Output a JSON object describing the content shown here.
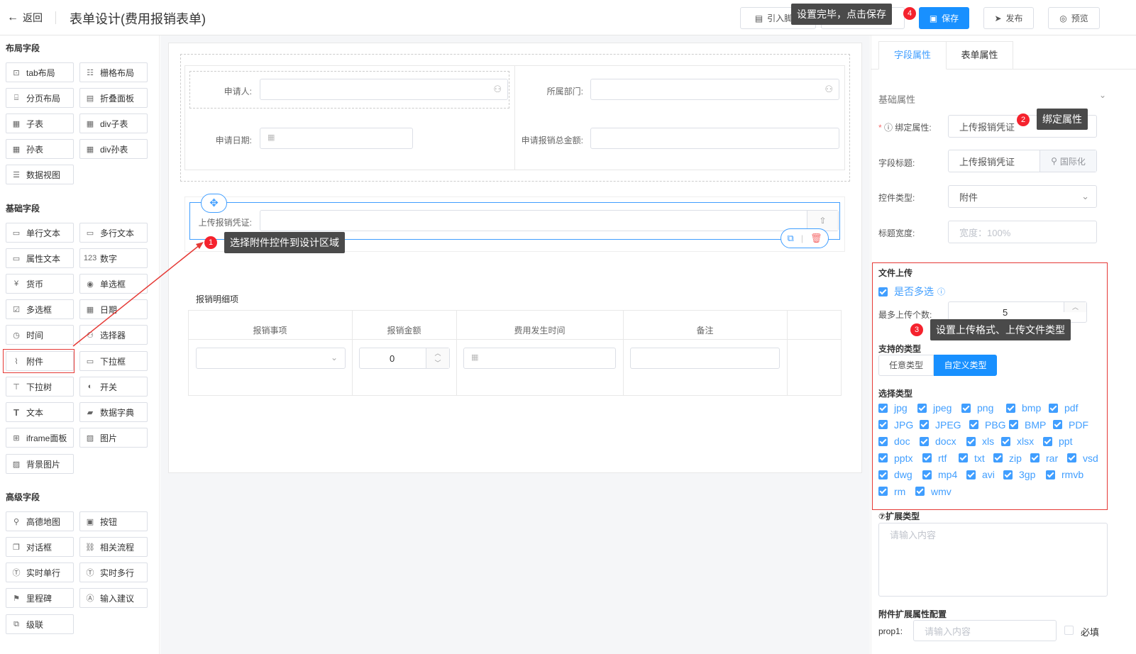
{
  "header": {
    "back_label": "返回",
    "title": "表单设计(费用报销表单)",
    "import_script": "引入脚本",
    "hidden_btn": "",
    "save": "保存",
    "publish": "发布",
    "preview": "预览"
  },
  "callouts": {
    "c1": "选择附件控件到设计区域",
    "c2": "绑定属性",
    "c3": "设置上传格式、上传文件类型",
    "c4": "设置完毕，点击保存",
    "n1": "1",
    "n2": "2",
    "n3": "3",
    "n4": "4"
  },
  "left": {
    "layout_title": "布局字段",
    "layout": [
      "tab布局",
      "栅格布局",
      "分页布局",
      "折叠面板",
      "子表",
      "div子表",
      "孙表",
      "div孙表",
      "数据视图"
    ],
    "basic_title": "基础字段",
    "basic": [
      "单行文本",
      "多行文本",
      "属性文本",
      "数字",
      "货币",
      "单选框",
      "多选框",
      "日期",
      "时间",
      "选择器",
      "附件",
      "下拉框",
      "下拉树",
      "开关",
      "文本",
      "数据字典",
      "iframe面板",
      "图片",
      "背景图片"
    ],
    "advanced_title": "高级字段",
    "advanced": [
      "高德地图",
      "按钮",
      "对话框",
      "相关流程",
      "实时单行",
      "实时多行",
      "里程碑",
      "输入建议",
      "级联"
    ]
  },
  "canvas": {
    "applicant": "申请人:",
    "department": "所属部门:",
    "apply_date": "申请日期:",
    "total_amount": "申请报销总金额:",
    "upload_label": "上传报销凭证:",
    "detail_title": "报销明细项",
    "columns": [
      "报销事项",
      "报销金额",
      "费用发生时间",
      "备注"
    ],
    "amount_value": "0"
  },
  "right": {
    "tab_field": "字段属性",
    "tab_form": "表单属性",
    "basic_props": "基础属性",
    "bind_label": "绑定属性:",
    "bind_value": "上传报销凭证",
    "title_label": "字段标题:",
    "title_value": "上传报销凭证",
    "i18n": "国际化",
    "type_label": "控件类型:",
    "type_value": "附件",
    "width_label": "标题宽度:",
    "width_placeholder": "宽度：100%",
    "upload_title": "文件上传",
    "multi_label": "是否多选",
    "max_label": "最多上传个数:",
    "max_value": "5",
    "support_title": "支持的类型",
    "any_type": "任意类型",
    "custom_type": "自定义类型",
    "select_title": "选择类型",
    "types": [
      [
        "jpg",
        "jpeg",
        "png",
        "bmp",
        "pdf"
      ],
      [
        "JPG",
        "JPEG",
        "PBG",
        "BMP",
        "PDF"
      ],
      [
        "doc",
        "docx",
        "xls",
        "xlsx",
        "ppt"
      ],
      [
        "pptx",
        "rtf",
        "txt",
        "zip",
        "rar",
        "vsd"
      ],
      [
        "dwg",
        "mp4",
        "avi",
        "3gp",
        "rmvb"
      ],
      [
        "rm",
        "wmv"
      ]
    ],
    "ext_title": "⑦扩展类型",
    "ext_placeholder": "请输入内容",
    "attach_title": "附件扩展属性配置",
    "prop1_label": "prop1:",
    "prop1_placeholder": "请输入内容",
    "required": "必填"
  },
  "colors": {
    "primary": "#1890ff",
    "callout": "#4a4a4a",
    "badge": "#f5222d",
    "highlight": "#e53935"
  }
}
